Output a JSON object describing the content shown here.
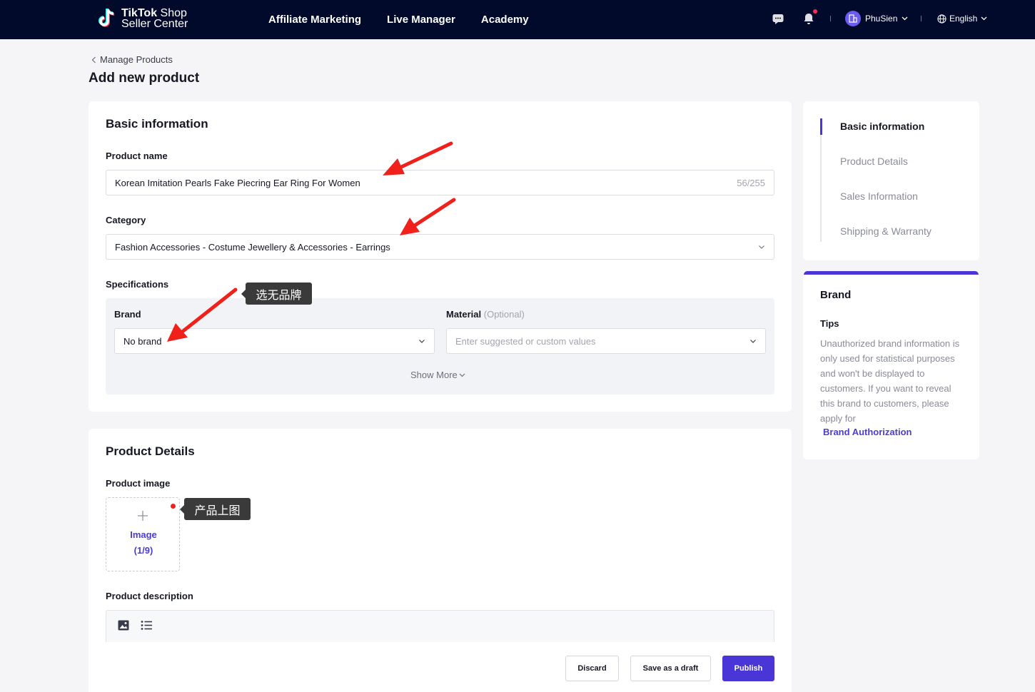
{
  "topbar": {
    "logo_line1_bold": "TikTok",
    "logo_line1_rest": "Shop",
    "logo_line2": "Seller Center",
    "nav": [
      "Affiliate Marketing",
      "Live Manager",
      "Academy"
    ],
    "username": "PhuSien",
    "language": "English",
    "icons": [
      "chat-icon",
      "bell-icon",
      "user-avatar-icon",
      "globe-icon"
    ]
  },
  "breadcrumb": {
    "label": "Manage Products"
  },
  "page_title": "Add new product",
  "basic_info": {
    "title": "Basic information",
    "product_name_label": "Product name",
    "product_name_value": "Korean Imitation Pearls Fake Piecring Ear Ring For Women",
    "product_name_counter": "56/255",
    "category_label": "Category",
    "category_value": "Fashion Accessories - Costume Jewellery & Accessories - Earrings",
    "specifications_label": "Specifications",
    "brand_label": "Brand",
    "brand_value": "No brand",
    "material_label": "Material",
    "material_optional": "(Optional)",
    "material_placeholder": "Enter suggested or custom values",
    "show_more": "Show More"
  },
  "product_details": {
    "title": "Product Details",
    "image_label": "Product image",
    "image_button": "Image",
    "image_count": "(1/9)",
    "description_label": "Product description"
  },
  "actions": {
    "discard": "Discard",
    "save_draft": "Save as a draft",
    "publish": "Publish"
  },
  "side_nav": {
    "items": [
      "Basic information",
      "Product Details",
      "Sales Information",
      "Shipping & Warranty"
    ],
    "active_index": 0
  },
  "brand_panel": {
    "title": "Brand",
    "tips_label": "Tips",
    "tips_text": "Unauthorized brand information is only used for statistical purposes and won't be displayed to customers. If you want to reveal this brand to customers, please apply for",
    "link": "Brand Authorization"
  },
  "annotations": {
    "brand_tip": "选无品牌",
    "image_tip": "产品上图"
  },
  "colors": {
    "topbar": "#020a2c",
    "accent": "#4a36d6",
    "arrow": "#f0201a"
  }
}
